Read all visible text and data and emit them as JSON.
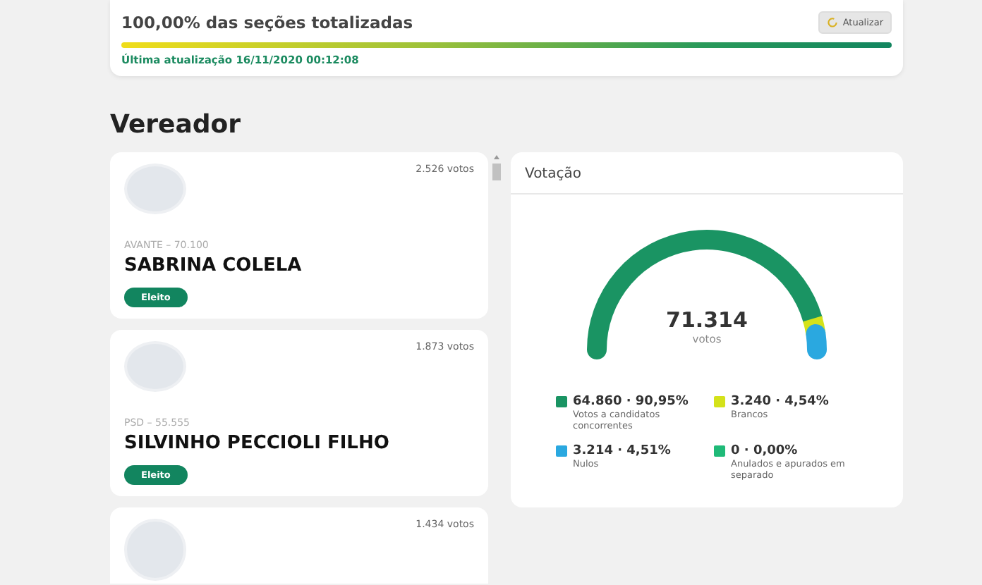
{
  "progress": {
    "title": "100,00% das seções totalizadas",
    "button": "Atualizar",
    "level": 1,
    "updated": "Última atualização 16/11/2020 00:12:08"
  },
  "section_title": "Vereador",
  "candidates": [
    {
      "votes": "2.526 votos",
      "party": "AVANTE – 70.100",
      "name": "SABRINA COLELA",
      "status": "Eleito"
    },
    {
      "votes": "1.873 votos",
      "party": "PSD – 55.555",
      "name": "SILVINHO PECCIOLI FILHO",
      "status": "Eleito"
    },
    {
      "votes": "1.434 votos"
    }
  ],
  "votacao": {
    "title": "Votação",
    "total": "71.314",
    "total_label": "votos",
    "legend": [
      {
        "value": "64.860 · 90,95%",
        "label": "Votos a candidatos concorrentes",
        "color": "#1a9463"
      },
      {
        "value": "3.240 · 4,54%",
        "label": "Brancos",
        "color": "#d4e21a"
      },
      {
        "value": "3.214 · 4,51%",
        "label": "Nulos",
        "color": "#2aa8e0"
      },
      {
        "value": "0 · 0,00%",
        "label": "Anulados e apurados em separado",
        "color": "#1fba78"
      }
    ]
  }
}
